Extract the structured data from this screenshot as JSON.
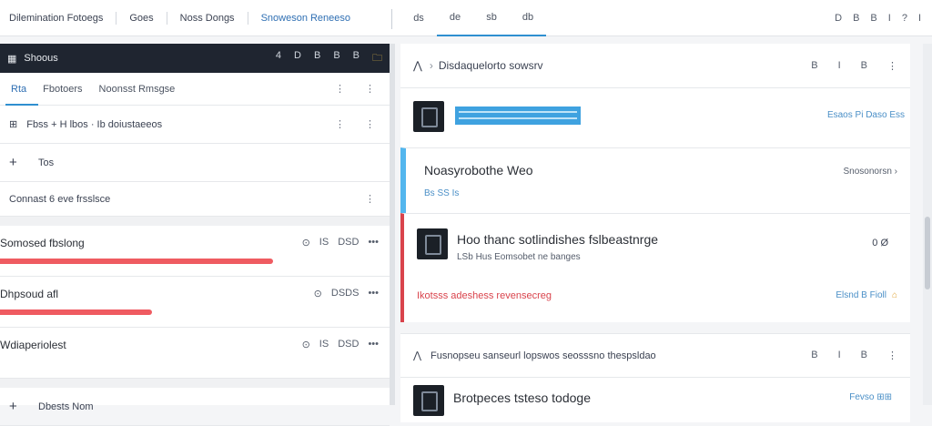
{
  "topbar": {
    "nav": [
      "Dilemination Fotoegs",
      "Goes",
      "Noss Dongs",
      "Snoweson Reneeso"
    ],
    "tabs": [
      "ds",
      "de",
      "sb",
      "db"
    ],
    "tools": [
      "D",
      "B",
      "B",
      "I",
      "?",
      "I"
    ]
  },
  "left": {
    "header": {
      "title": "Shoous",
      "tools": [
        "4",
        "D",
        "B",
        "B",
        "B",
        "🗀"
      ]
    },
    "subtabs": [
      "Rta",
      "Fbotoers",
      "Noonsst Rmsgse"
    ],
    "breadcrumb": "Fbss  +  H lbos  ·  Ib doiustaeeos",
    "add_label": "Tos",
    "section_label": "Connast 6 eve frsslsce",
    "items": [
      {
        "name": "Somosed fbslong",
        "meta": [
          "⊙",
          "IS",
          "DSD"
        ],
        "progress": 0.7
      },
      {
        "name": "Dhpsoud afl",
        "meta": [
          "⊙",
          "DSDS"
        ],
        "progress": 0.39
      },
      {
        "name": "Wdiaperiolest",
        "meta": [
          "⊙",
          "IS",
          "DSD"
        ],
        "progress": 0
      }
    ],
    "footer_label": "Dbests Nom"
  },
  "right": {
    "header": {
      "title": "Disdaquelorto sowsrv",
      "tools": [
        "B",
        "I",
        "B",
        "⋮"
      ]
    },
    "card1": {
      "action": "Esaos Pi Daso   Ess"
    },
    "card2": {
      "title": "Noasyrobothe Weo",
      "sub": "Bs SS Is",
      "action": "Snosonorsn ›"
    },
    "card3": {
      "title": "Hoo thanc sotlindishes fslbeastnrge",
      "desc": "LSb  Hus  Eomsobet ne banges",
      "meta": "0  Ø",
      "tag": "Ikotsss adeshess revensecreg",
      "action": "Elsnd B Fioll",
      "action_icon": "⌂"
    },
    "card4": {
      "title": "Fusnopseu sanseurl lopswos seosssno thespsldao",
      "tools": [
        "B",
        "I",
        "B",
        "⋮"
      ]
    },
    "card5": {
      "title": "Brotpeces tsteso todoge",
      "action": "Fevso   ⊞⊞"
    }
  }
}
